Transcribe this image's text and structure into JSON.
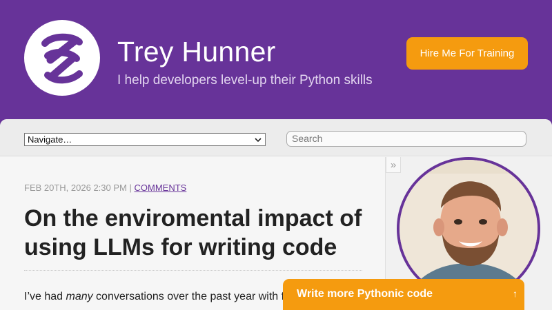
{
  "header": {
    "title": "Trey Hunner",
    "subtitle": "I help developers level-up their Python skills",
    "hire_button": "Hire Me For Training"
  },
  "nav": {
    "select_value": "Navigate…",
    "search_placeholder": "Search"
  },
  "post": {
    "date": "FEB 20TH, 2026 2:30 PM",
    "separator": "|",
    "comments_link": "COMMENTS",
    "title": "On the enviromental impact of using LLMs for writing code",
    "body_start": "I’ve had ",
    "body_emph": "many",
    "body_rest": " conversations over the past year with fr"
  },
  "sidebar": {
    "collapse_glyph": "»"
  },
  "cta": {
    "label": "Write more Pythonic code",
    "arrow": "↑"
  },
  "colors": {
    "brand_purple": "#673399",
    "accent_orange": "#f59b0f"
  }
}
